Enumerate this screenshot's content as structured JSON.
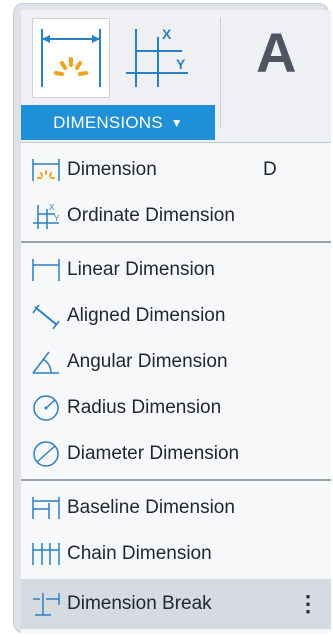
{
  "ribbon": {
    "tool_icons": [
      "dimension-tool-icon",
      "ordinate-tool-icon"
    ],
    "text_button_letter": "A",
    "panel_label": "DIMENSIONS",
    "panel_caret": "▼"
  },
  "menu": {
    "items": [
      {
        "label": "Dimension",
        "shortcut": "D",
        "icon": "dimension-icon"
      },
      {
        "label": "Ordinate Dimension",
        "icon": "ordinate-dimension-icon"
      },
      {
        "label": "Linear Dimension",
        "icon": "linear-dimension-icon"
      },
      {
        "label": "Aligned Dimension",
        "icon": "aligned-dimension-icon"
      },
      {
        "label": "Angular Dimension",
        "icon": "angular-dimension-icon"
      },
      {
        "label": "Radius Dimension",
        "icon": "radius-dimension-icon"
      },
      {
        "label": "Diameter Dimension",
        "icon": "diameter-dimension-icon"
      },
      {
        "label": "Baseline Dimension",
        "icon": "baseline-dimension-icon"
      },
      {
        "label": "Chain Dimension",
        "icon": "chain-dimension-icon"
      },
      {
        "label": "Dimension Break",
        "icon": "dimension-break-icon",
        "more": "⋮"
      }
    ]
  },
  "colors": {
    "accent": "#1f8fd8",
    "icon_blue": "#2b7fc4",
    "icon_orange": "#f2a31c"
  }
}
